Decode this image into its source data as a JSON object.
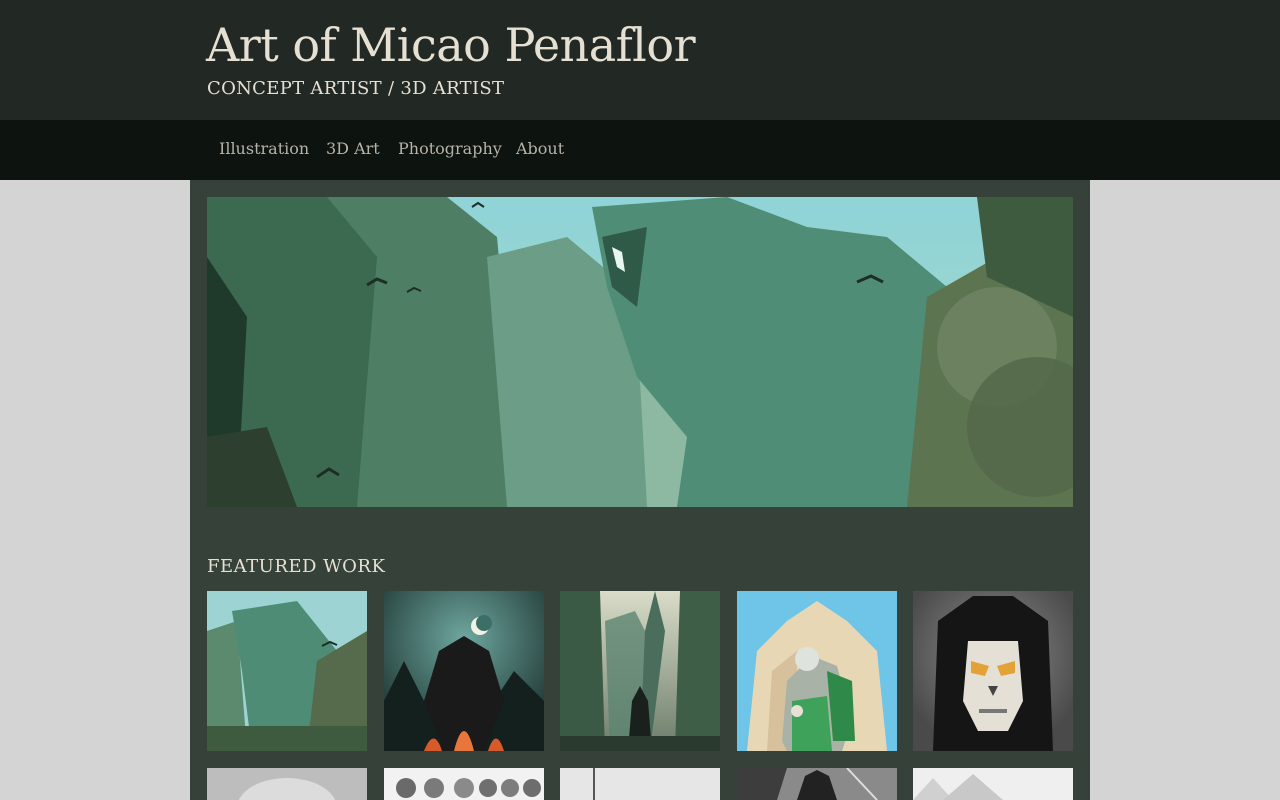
{
  "header": {
    "title": "Art of Micao Penaflor",
    "subtitle": "CONCEPT ARTIST / 3D ARTIST"
  },
  "nav": {
    "items": [
      {
        "label": "Illustration"
      },
      {
        "label": "3D Art"
      },
      {
        "label": "Photography"
      },
      {
        "label": "About"
      }
    ]
  },
  "featured": {
    "heading": "FEATURED WORK"
  },
  "colors": {
    "header_bg": "#222925",
    "nav_bg": "#0d130f",
    "content_bg": "#364139",
    "page_bg": "#d4d4d4",
    "text_light": "#e6e0d3"
  }
}
